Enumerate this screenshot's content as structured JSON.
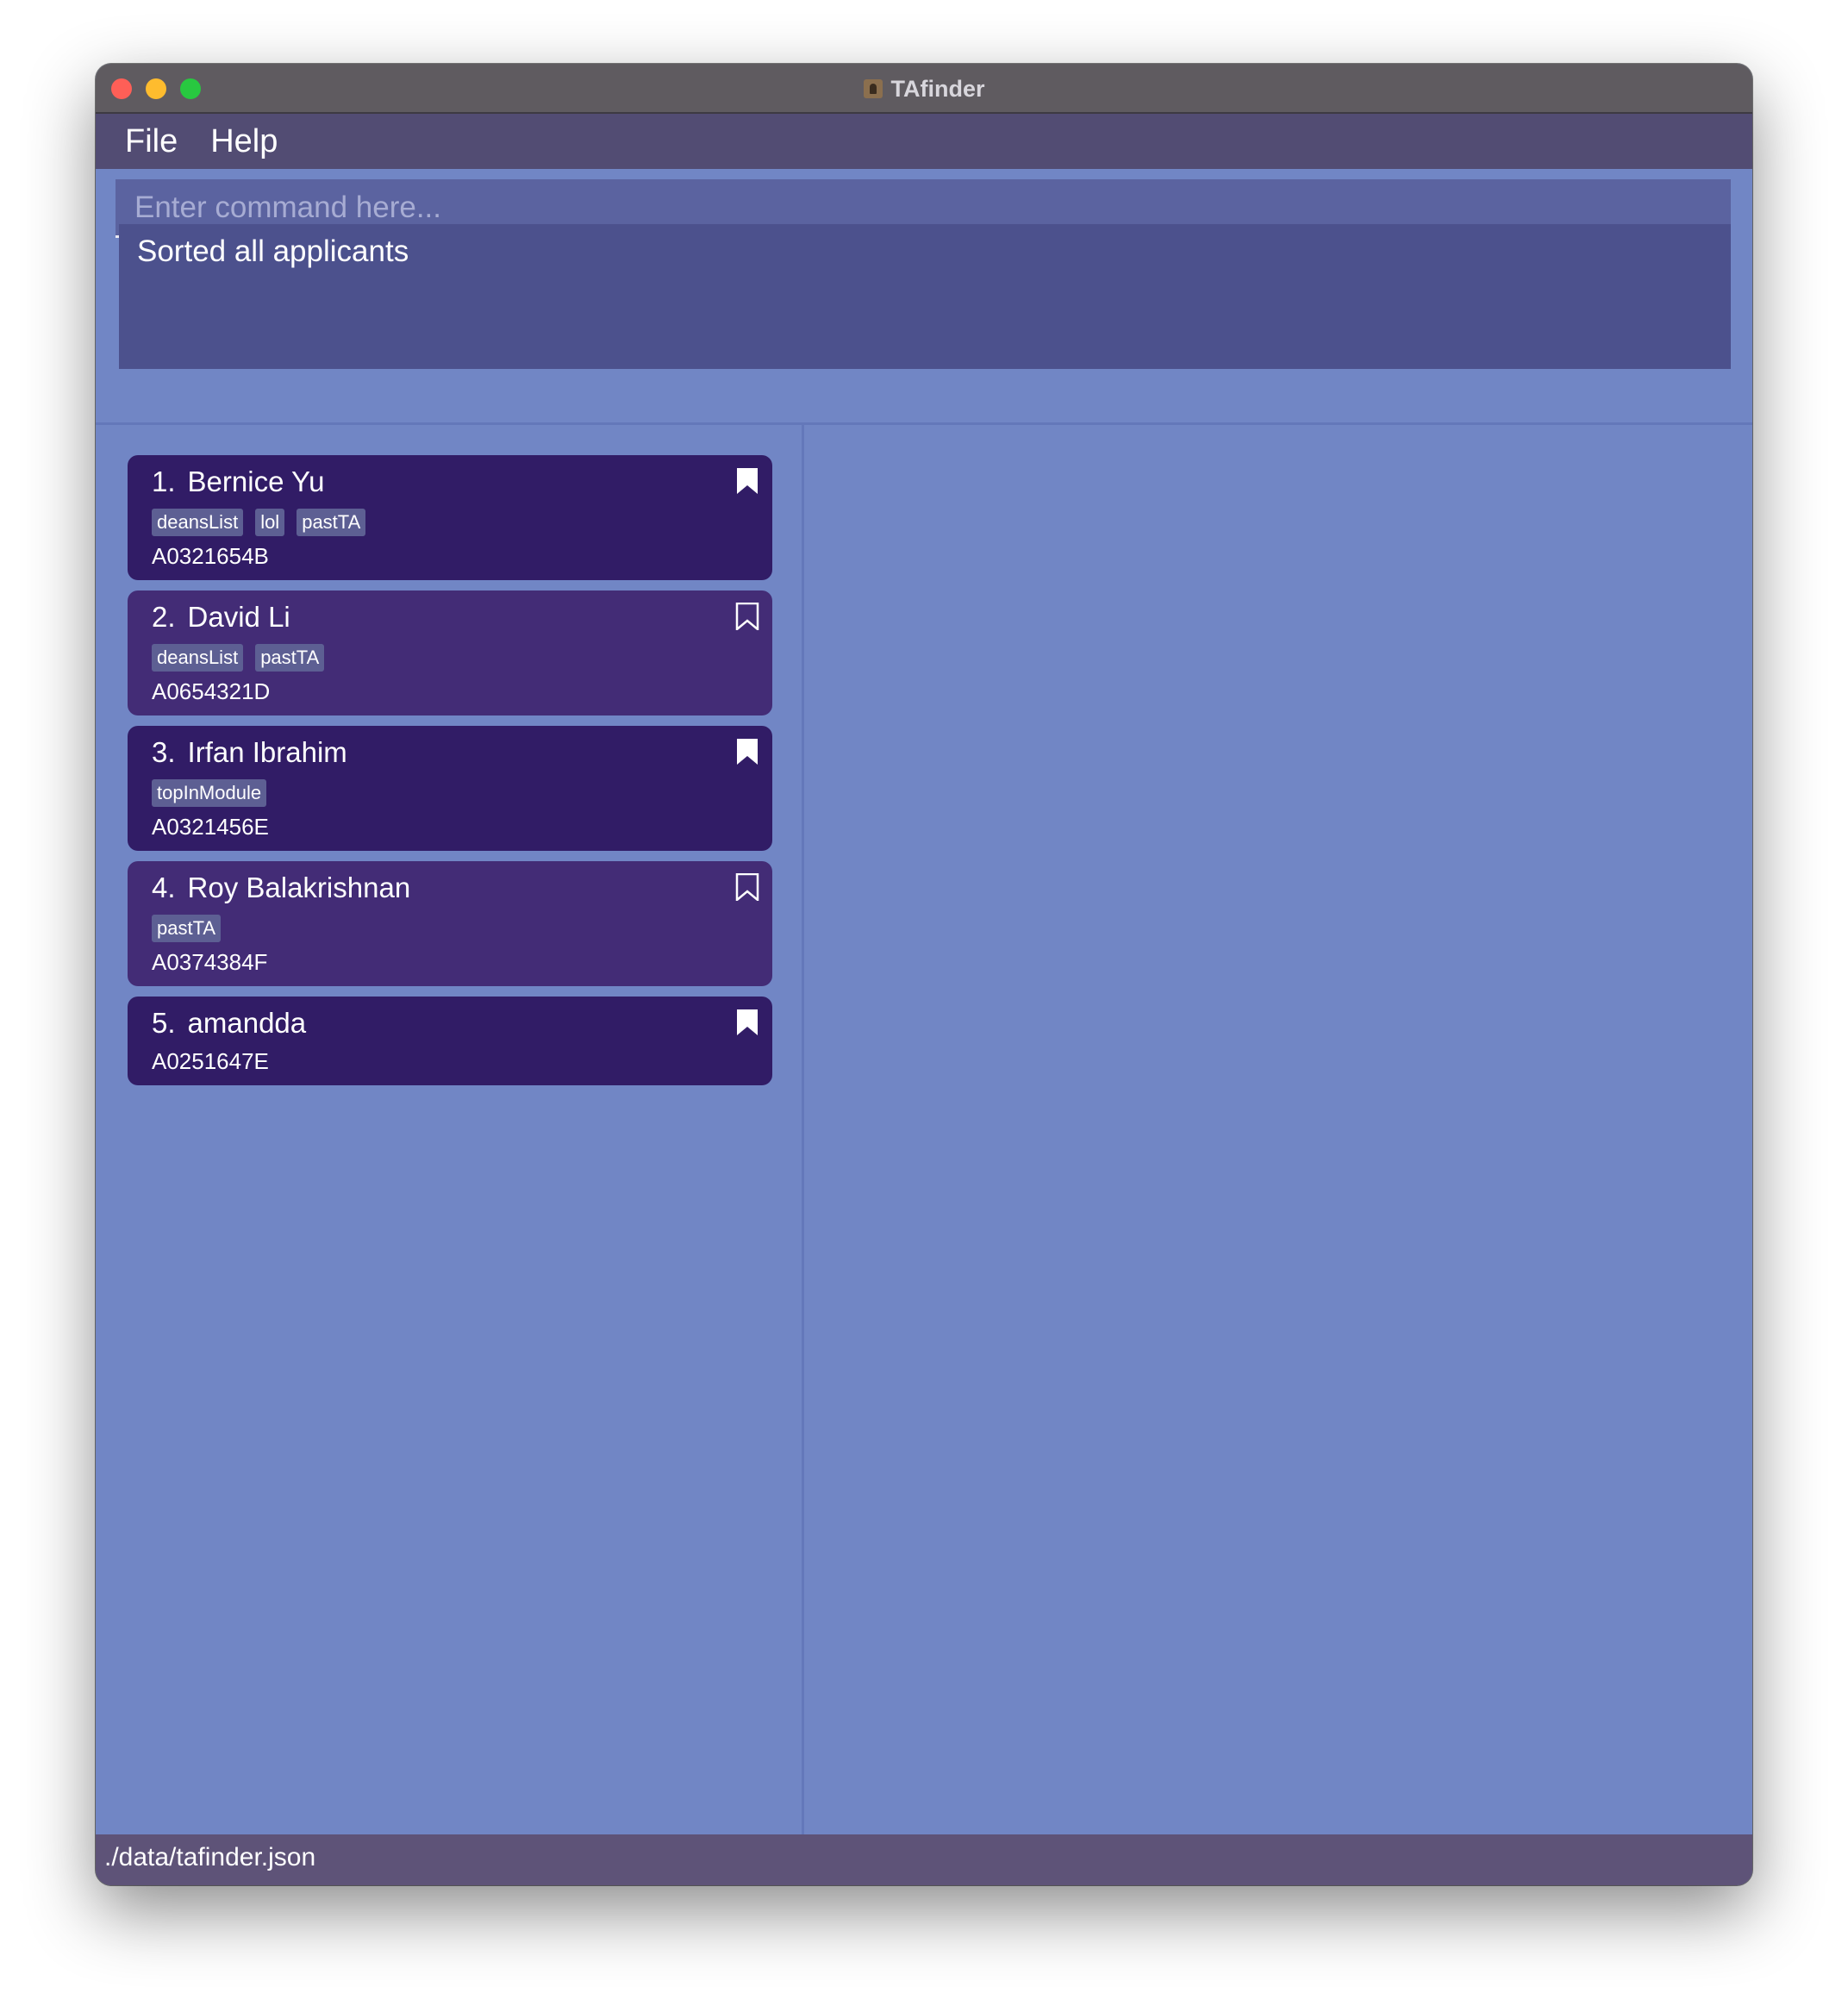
{
  "window": {
    "title": "TAfinder"
  },
  "menu": {
    "items": [
      "File",
      "Help"
    ]
  },
  "command": {
    "placeholder": "Enter command here...",
    "value": ""
  },
  "result": {
    "message": "Sorted all applicants"
  },
  "applicants": [
    {
      "index": "1.",
      "name": "Bernice Yu",
      "tags": [
        "deansList",
        "lol",
        "pastTA"
      ],
      "id": "A0321654B",
      "bookmarked": true
    },
    {
      "index": "2.",
      "name": "David Li",
      "tags": [
        "deansList",
        "pastTA"
      ],
      "id": "A0654321D",
      "bookmarked": false
    },
    {
      "index": "3.",
      "name": "Irfan Ibrahim",
      "tags": [
        "topInModule"
      ],
      "id": "A0321456E",
      "bookmarked": true
    },
    {
      "index": "4.",
      "name": "Roy Balakrishnan",
      "tags": [
        "pastTA"
      ],
      "id": "A0374384F",
      "bookmarked": false
    },
    {
      "index": "5.",
      "name": "amandda",
      "tags": [],
      "id": "A0251647E",
      "bookmarked": true
    }
  ],
  "status": {
    "path": "./data/tafinder.json"
  },
  "colors": {
    "background": "#7186c5",
    "card_dark": "#311c66",
    "card_light": "#432c76",
    "result_box": "#4c518d",
    "menubar": "#524c73"
  }
}
